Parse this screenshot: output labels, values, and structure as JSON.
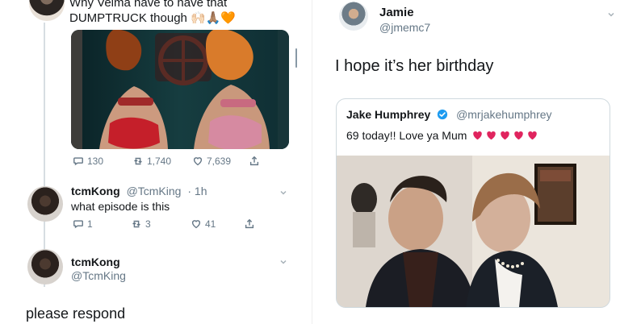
{
  "left": {
    "original_tweet": {
      "text": "Why Velma have to have that DUMPTRUCK though",
      "emoji": "🙌🏻🙏🏽🧡",
      "stats": {
        "replies": "130",
        "retweets": "1,740",
        "likes": "7,639"
      }
    },
    "reply1": {
      "name": "tcmKong",
      "handle": "@TcmKing",
      "time": "· 1h",
      "text": "what episode is this",
      "stats": {
        "replies": "1",
        "retweets": "3",
        "likes": "41"
      }
    },
    "reply2": {
      "name": "tcmKong",
      "handle": "@TcmKing",
      "text": "please respond"
    }
  },
  "right": {
    "user": {
      "name": "Jamie",
      "handle": "@jmemc7",
      "text": "I hope it’s her birthday"
    },
    "quote": {
      "name": "Jake Humphrey",
      "handle": "@mrjakehumphrey",
      "text": "69 today!! Love ya Mum"
    }
  },
  "colors": {
    "text": "#14171a",
    "muted": "#657786",
    "verified": "#1d9bf0",
    "heart": "#e0245e",
    "border": "#cfd9de"
  }
}
